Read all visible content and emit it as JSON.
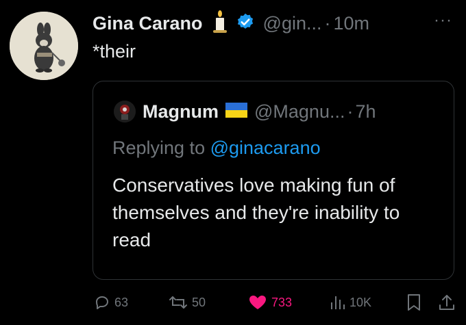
{
  "post": {
    "author_name": "Gina Carano",
    "author_handle": "@gin...",
    "separator": "·",
    "time": "10m",
    "more_label": "···",
    "text": "*their"
  },
  "quoted": {
    "author_name": "Magnum",
    "author_handle": "@Magnu...",
    "separator": "·",
    "time": "7h",
    "replying_prefix": "Replying to ",
    "replying_handle": "@ginacarano",
    "text": "Conservatives love making fun of themselves and they're inability to read"
  },
  "actions": {
    "replies": "63",
    "reposts": "50",
    "likes": "733",
    "views": "10K"
  },
  "icons": {
    "author_emoji": "candle-icon",
    "verified": "verified-badge-icon",
    "quoted_emoji": "ukraine-flag-icon",
    "reply": "reply-icon",
    "repost": "repost-icon",
    "like": "heart-icon",
    "views": "views-icon",
    "bookmark": "bookmark-icon",
    "share": "share-icon"
  },
  "colors": {
    "background": "#000000",
    "text": "#e7e9ea",
    "secondary": "#71767b",
    "link": "#1d9bf0",
    "like": "#f91880",
    "verified": "#1d9bf0"
  }
}
